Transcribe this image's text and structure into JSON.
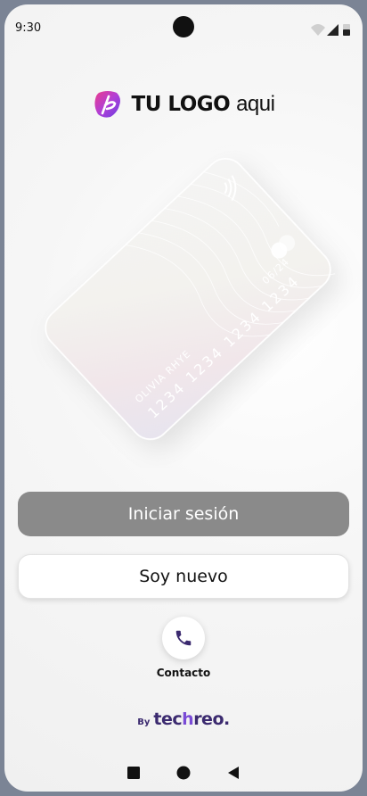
{
  "status_bar": {
    "time": "9:30"
  },
  "logo": {
    "bold": "TU LOGO",
    "light": "aqui"
  },
  "card": {
    "name": "OLIVIA RHYE",
    "number": "1234 1234 1234 1234",
    "expiry": "06/24"
  },
  "buttons": {
    "login": "Iniciar sesión",
    "new_user": "Soy nuevo"
  },
  "contact": {
    "label": "Contacto"
  },
  "brand": {
    "by": "By",
    "name_a": "tec",
    "name_b": "h",
    "name_c": "reo."
  },
  "colors": {
    "accent": "#7a4bd6",
    "brand_dark": "#3b2a6f",
    "login_bg": "#8a8a8a"
  }
}
